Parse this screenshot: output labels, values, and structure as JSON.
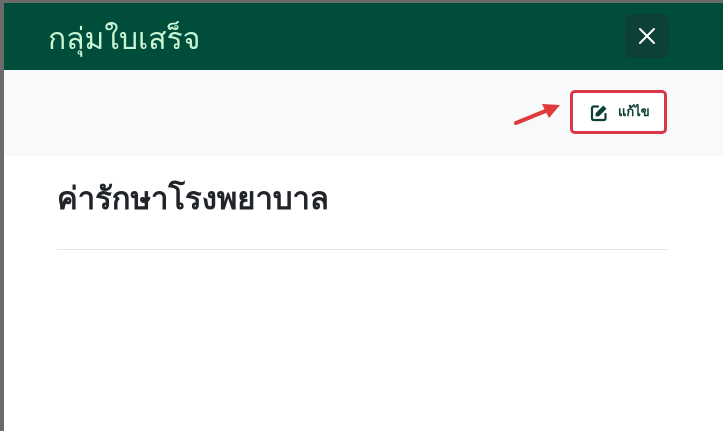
{
  "modal": {
    "title": "กลุ่มใบเสร็จ",
    "close_icon": "close-icon"
  },
  "toolbar": {
    "edit_label": "แก้ไข",
    "edit_icon": "edit-icon"
  },
  "content": {
    "title": "ค่ารักษาโรงพยาบาล"
  },
  "colors": {
    "header_background": "#004d3c",
    "header_title": "#c8f5d2",
    "toolbar_background": "#f8f9fa",
    "edit_highlight_border": "#dc3545",
    "annotation_arrow": "#e03a3a",
    "edit_text": "#0d4036"
  }
}
